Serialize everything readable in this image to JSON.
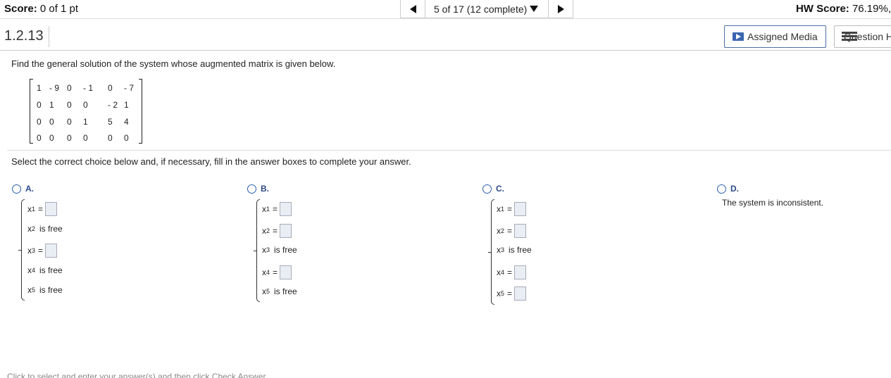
{
  "header": {
    "score_label": "Score:",
    "score_value": "0 of 1 pt",
    "nav_position": "5 of 17 (12 complete)",
    "hw_label": "HW Score:",
    "hw_value": "76.19%,"
  },
  "question": {
    "number": "1.2.13",
    "assigned_media_label": "Assigned Media",
    "question_help_label": "Question Help",
    "prompt": "Find the general solution of the system whose augmented matrix is given below.",
    "instruction": "Select the correct choice below and, if necessary, fill in the answer boxes to complete your answer."
  },
  "matrix": {
    "rows": [
      [
        "1",
        "- 9",
        "0",
        "- 1",
        "0",
        "- 7"
      ],
      [
        "0",
        "1",
        "0",
        "0",
        "- 2",
        "1"
      ],
      [
        "0",
        "0",
        "0",
        "1",
        "5",
        "4"
      ],
      [
        "0",
        "0",
        "0",
        "0",
        "0",
        "0"
      ]
    ]
  },
  "choices": {
    "a": {
      "label": "A.",
      "lines": [
        {
          "var": "x",
          "sub": "1",
          "type": "box"
        },
        {
          "var": "x",
          "sub": "2",
          "type": "free",
          "text": "is free"
        },
        {
          "var": "x",
          "sub": "3",
          "type": "box"
        },
        {
          "var": "x",
          "sub": "4",
          "type": "free",
          "text": "is free"
        },
        {
          "var": "x",
          "sub": "5",
          "type": "free",
          "text": "is free"
        }
      ]
    },
    "b": {
      "label": "B.",
      "lines": [
        {
          "var": "x",
          "sub": "1",
          "type": "box"
        },
        {
          "var": "x",
          "sub": "2",
          "type": "box"
        },
        {
          "var": "x",
          "sub": "3",
          "type": "free",
          "text": "is free"
        },
        {
          "var": "x",
          "sub": "4",
          "type": "box"
        },
        {
          "var": "x",
          "sub": "5",
          "type": "free",
          "text": "is free"
        }
      ]
    },
    "c": {
      "label": "C.",
      "lines": [
        {
          "var": "x",
          "sub": "1",
          "type": "box"
        },
        {
          "var": "x",
          "sub": "2",
          "type": "box"
        },
        {
          "var": "x",
          "sub": "3",
          "type": "free",
          "text": "is free"
        },
        {
          "var": "x",
          "sub": "4",
          "type": "box"
        },
        {
          "var": "x",
          "sub": "5",
          "type": "box"
        }
      ]
    },
    "d": {
      "label": "D.",
      "text": "The system is inconsistent."
    }
  },
  "eq_sign": "=",
  "footer": "Click to select and enter your answer(s) and then click Check Answer.",
  "colors": {
    "choice_label": "#2c4a8a",
    "radio_border": "#2c5fb3",
    "answer_box": "#e8eef3",
    "media_button_border": "#4a6fa5"
  }
}
